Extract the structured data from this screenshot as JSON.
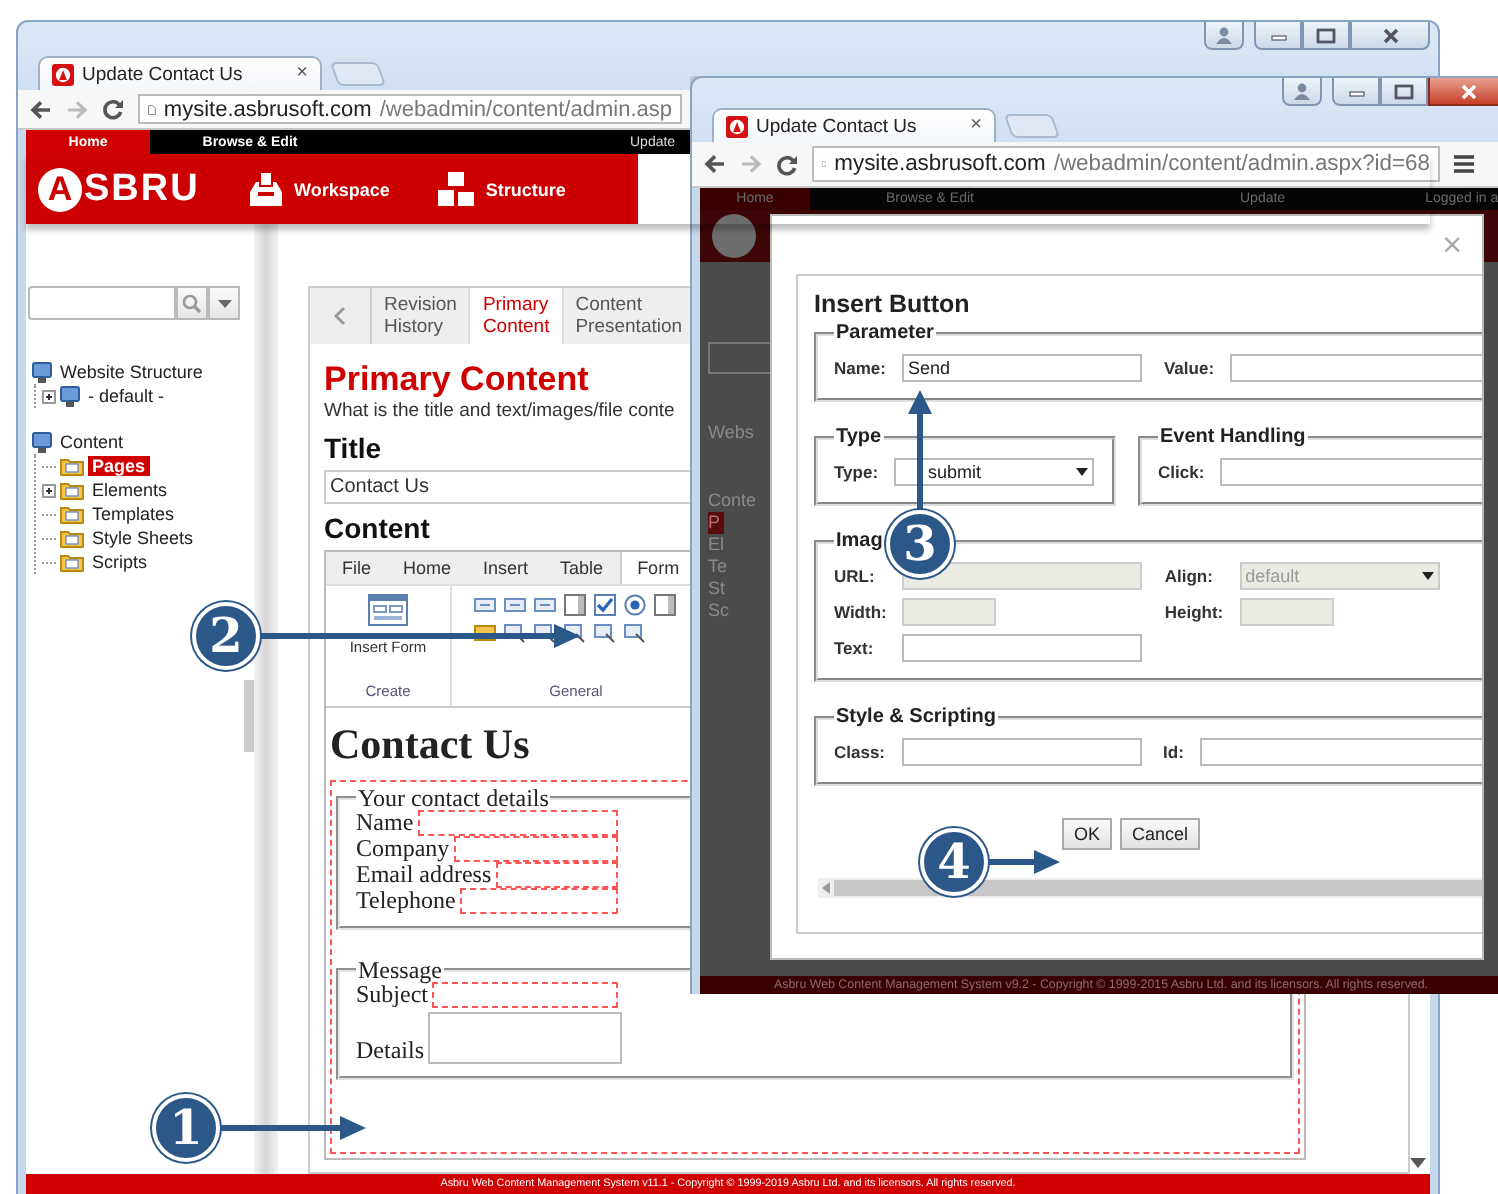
{
  "back_window": {
    "tab": {
      "title": "Update Contact Us",
      "close": "×"
    },
    "address": {
      "host": "mysite.asbrusoft.com",
      "path": "/webadmin/content/admin.asp"
    },
    "menu": [
      {
        "label": "Home",
        "selected": true
      },
      {
        "label": "Browse & Edit",
        "selected": false
      },
      {
        "label": "Update",
        "selected": false
      }
    ],
    "logo": {
      "mark": "A",
      "word": "SBRU"
    },
    "header_links": [
      {
        "label": "Workspace",
        "kind": "workspace"
      },
      {
        "label": "Structure",
        "kind": "structure"
      }
    ],
    "sidebar": {
      "tree": [
        {
          "label": "Website Structure",
          "kind": "site",
          "collapsed": false,
          "selected": false,
          "children": [
            {
              "label": "- default -",
              "kind": "site",
              "collapsed": true,
              "selected": false
            }
          ]
        },
        {
          "label": "Content",
          "kind": "site",
          "collapsed": false,
          "selected": false,
          "children": [
            {
              "label": "Pages",
              "kind": "folder",
              "collapsed": false,
              "selected": true
            },
            {
              "label": "Elements",
              "kind": "folder",
              "collapsed": true,
              "selected": false
            },
            {
              "label": "Templates",
              "kind": "folder",
              "collapsed": false,
              "selected": false
            },
            {
              "label": "Style Sheets",
              "kind": "folder",
              "collapsed": false,
              "selected": false
            },
            {
              "label": "Scripts",
              "kind": "folder",
              "collapsed": false,
              "selected": false
            }
          ]
        }
      ]
    },
    "tabs": [
      {
        "label": "Revision History",
        "selected": false
      },
      {
        "label": "Primary Content",
        "selected": true
      },
      {
        "label": "Content Presentation",
        "selected": false
      }
    ],
    "heading": "Primary Content",
    "description": "What is the title and text/images/file conte",
    "title_label": "Title",
    "title_value": "Contact Us",
    "content_label": "Content",
    "editor": {
      "tabs": [
        {
          "label": "File",
          "selected": false
        },
        {
          "label": "Home",
          "selected": false
        },
        {
          "label": "Insert",
          "selected": false
        },
        {
          "label": "Table",
          "selected": false
        },
        {
          "label": "Form",
          "selected": true
        }
      ],
      "groups": [
        {
          "label": "Create",
          "button": "Insert Form"
        },
        {
          "label": "General"
        }
      ],
      "document": {
        "heading": "Contact Us",
        "fieldsets": [
          {
            "legend": "Your contact details",
            "fields": [
              {
                "label": "Name",
                "kind": "text"
              },
              {
                "label": "Company",
                "kind": "text"
              },
              {
                "label": "Email address",
                "kind": "text"
              },
              {
                "label": "Telephone",
                "kind": "text"
              }
            ]
          },
          {
            "legend": "Message",
            "fields": [
              {
                "label": "Subject",
                "kind": "text"
              },
              {
                "label": "Details",
                "kind": "textarea"
              }
            ]
          }
        ]
      }
    },
    "footer": "Asbru Web Content Management System v11.1 - Copyright © 1999-2019 Asbru Ltd. and its licensors. All rights reserved."
  },
  "front_window": {
    "tab": {
      "title": "Update Contact Us",
      "close": "×"
    },
    "address": {
      "host": "mysite.asbrusoft.com",
      "path": "/webadmin/content/admin.aspx?id=68"
    },
    "menu": [
      {
        "label": "Home",
        "selected": true
      },
      {
        "label": "Browse & Edit",
        "selected": false
      },
      {
        "label": "Update",
        "selected": false
      },
      {
        "label": "Logged in a",
        "selected": false
      }
    ],
    "sidebar_fragments": [
      {
        "label": "Webs",
        "selected": false
      },
      {
        "label": "Conte",
        "selected": false
      },
      {
        "label": "P",
        "selected": true
      },
      {
        "label": "El",
        "selected": false
      },
      {
        "label": "Te",
        "selected": false
      },
      {
        "label": "St",
        "selected": false
      },
      {
        "label": "Sc",
        "selected": false
      }
    ],
    "dialog": {
      "close": "×",
      "title": "Insert Button",
      "sections": [
        {
          "legend": "Parameter",
          "fields": [
            {
              "label": "Name:",
              "kind": "text",
              "value": "Send",
              "disabled": false
            },
            {
              "label": "Value:",
              "kind": "text",
              "disabled": false
            }
          ]
        },
        {
          "legend": "Type",
          "fields": [
            {
              "label": "Type:",
              "kind": "select",
              "value": "submit",
              "disabled": false
            }
          ]
        },
        {
          "legend": "Event Handling",
          "fields": [
            {
              "label": "Click:",
              "kind": "text",
              "disabled": false
            }
          ]
        },
        {
          "legend": "Imag",
          "fields": [
            {
              "label": "URL:",
              "kind": "text",
              "disabled": true
            },
            {
              "label": "Align:",
              "kind": "select",
              "value": "default",
              "disabled": true
            },
            {
              "label": "Width:",
              "kind": "short",
              "disabled": true
            },
            {
              "label": "Height:",
              "kind": "short",
              "disabled": true
            },
            {
              "label": "Text:",
              "kind": "text",
              "disabled": false
            }
          ]
        },
        {
          "legend": "Style & Scripting",
          "fields": [
            {
              "label": "Class:",
              "kind": "text",
              "disabled": false
            },
            {
              "label": "Id:",
              "kind": "text",
              "disabled": false
            }
          ]
        }
      ],
      "buttons": [
        "OK",
        "Cancel"
      ]
    },
    "footer": "Asbru Web Content Management System v9.2 - Copyright © 1999-2015 Asbru Ltd. and its licensors. All rights reserved."
  },
  "callouts": [
    {
      "number": "1"
    },
    {
      "number": "2"
    },
    {
      "number": "3"
    },
    {
      "number": "4"
    }
  ]
}
